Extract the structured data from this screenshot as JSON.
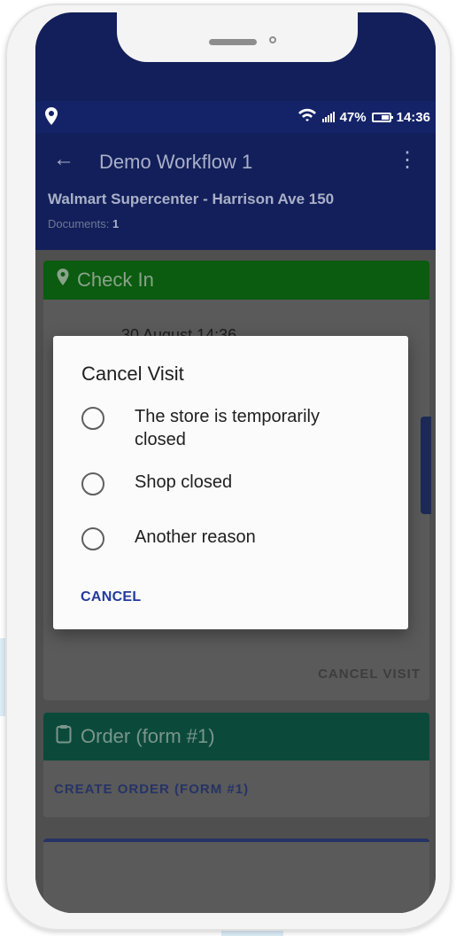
{
  "status_bar": {
    "battery": "47%",
    "time": "14:36"
  },
  "app_bar": {
    "title": "Demo Workflow 1",
    "subtitle": "Walmart Supercenter - Harrison Ave 150",
    "documents_label": "Documents:",
    "documents_count": "1"
  },
  "checkin_card": {
    "header": "Check In",
    "datetime": "30 August 14:36",
    "cancel_visit_label": "CANCEL VISIT"
  },
  "order_card": {
    "header": "Order (form #1)",
    "action_label": "CREATE ORDER (FORM #1)"
  },
  "dialog": {
    "title": "Cancel Visit",
    "options": [
      {
        "label": "The store is temporarily closed"
      },
      {
        "label": "Shop closed"
      },
      {
        "label": "Another reason"
      }
    ],
    "cancel_label": "CANCEL"
  },
  "colors": {
    "app_bar": "#142368",
    "check_in_header": "#0b5b10",
    "order_header": "#0b4a3a",
    "dialog_accent": "#233a9e"
  }
}
